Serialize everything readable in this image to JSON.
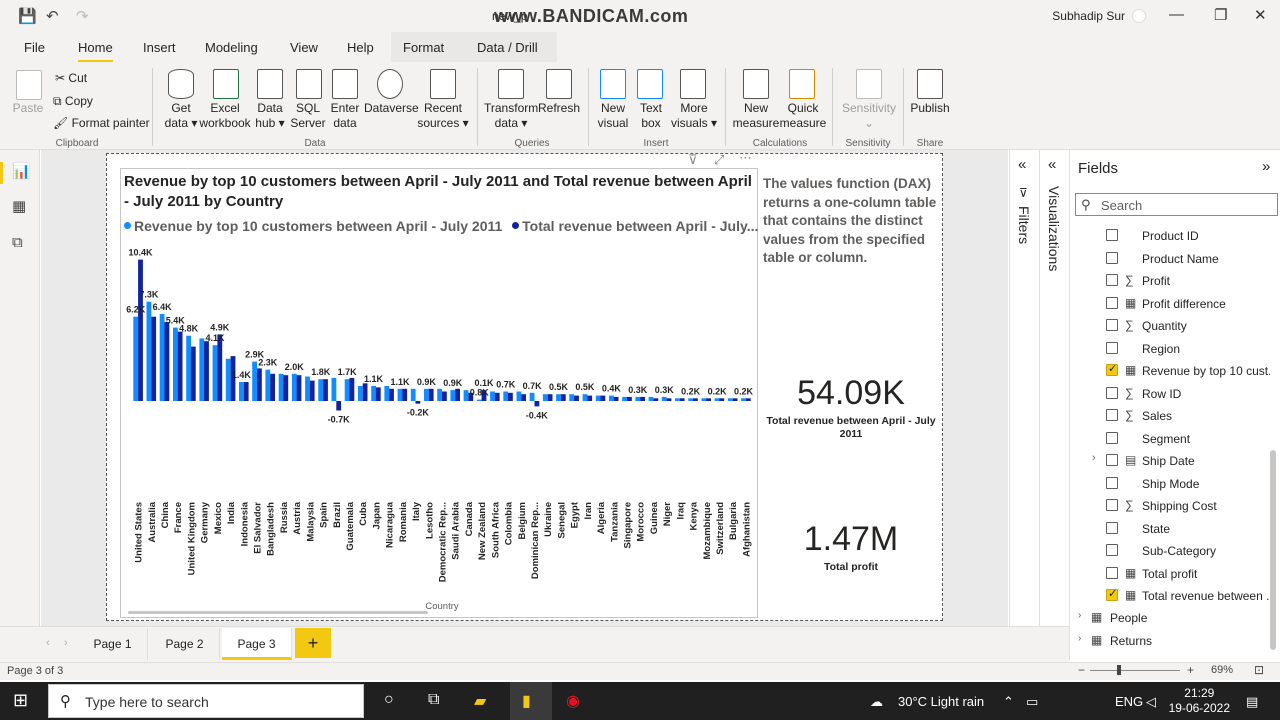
{
  "titlebar": {
    "title": "new_p",
    "watermark": "www.BANDICAM.com",
    "user": "Subhadip Sur"
  },
  "menu": [
    "File",
    "Home",
    "Insert",
    "Modeling",
    "View",
    "Help",
    "Format",
    "Data / Drill"
  ],
  "ribbon": {
    "paste": "Paste",
    "cut": "Cut",
    "copy": "Copy",
    "format_painter": "Format painter",
    "get_data": [
      "Get",
      "data ▾"
    ],
    "excel": [
      "Excel",
      "workbook"
    ],
    "data_hub": [
      "Data",
      "hub ▾"
    ],
    "sql": [
      "SQL",
      "Server"
    ],
    "enter_data": [
      "Enter",
      "data"
    ],
    "dataverse": "Dataverse",
    "recent": [
      "Recent",
      "sources ▾"
    ],
    "transform": [
      "Transform",
      "data ▾"
    ],
    "refresh": "Refresh",
    "new_visual": [
      "New",
      "visual"
    ],
    "text_box": [
      "Text",
      "box"
    ],
    "more_visuals": [
      "More",
      "visuals ▾"
    ],
    "new_measure": [
      "New",
      "measure"
    ],
    "quick_measure": [
      "Quick",
      "measure"
    ],
    "sensitivity": "Sensitivity",
    "publish": "Publish",
    "groups": [
      "Clipboard",
      "Data",
      "Queries",
      "Insert",
      "Calculations",
      "Sensitivity",
      "Share"
    ]
  },
  "chart_data": {
    "type": "bar",
    "title": "Revenue by top 10 customers between April - July 2011 and Total revenue between April - July 2011 by Country",
    "xlabel": "Country",
    "ylabel": "",
    "legend": "top",
    "categories": [
      "United States",
      "Australia",
      "China",
      "France",
      "United Kingdom",
      "Germany",
      "Mexico",
      "India",
      "Indonesia",
      "El Salvador",
      "Bangladesh",
      "Russia",
      "Austria",
      "Malaysia",
      "Spain",
      "Brazil",
      "Guatemala",
      "Cuba",
      "Japan",
      "Nicaragua",
      "Romania",
      "Italy",
      "Lesotho",
      "Democratic Rep...",
      "Saudi Arabia",
      "Canada",
      "New Zealand",
      "South Africa",
      "Colombia",
      "Belgium",
      "Dominican Rep...",
      "Ukraine",
      "Senegal",
      "Egypt",
      "Iran",
      "Algeria",
      "Tanzania",
      "Singapore",
      "Morocco",
      "Guinea",
      "Niger",
      "Iraq",
      "Kenya",
      "Mozambique",
      "Switzerland",
      "Bulgaria",
      "Afghanistan"
    ],
    "series": [
      {
        "name": "Revenue by top 10 customers between April - July 2011",
        "color": "#118dff",
        "values": [
          6.2,
          7.3,
          6.4,
          5.4,
          4.8,
          4.6,
          4.1,
          3.1,
          1.4,
          2.9,
          2.3,
          2.0,
          2.0,
          1.8,
          1.6,
          1.7,
          1.6,
          1.1,
          1.1,
          1.1,
          0.9,
          0.9,
          0.9,
          0.9,
          0.8,
          0.8,
          0.1,
          0.7,
          0.7,
          0.7,
          0.6,
          0.5,
          0.5,
          0.5,
          0.5,
          0.4,
          0.4,
          0.3,
          0.3,
          0.3,
          0.3,
          0.2,
          0.2,
          0.2,
          0.2,
          0.2,
          0.2
        ]
      },
      {
        "name": "Total revenue between April - July...",
        "color": "#12239e",
        "values": [
          10.4,
          6.2,
          5.8,
          5.1,
          4.0,
          4.4,
          4.9,
          3.3,
          1.4,
          2.4,
          2.0,
          1.9,
          1.9,
          1.5,
          1.6,
          -0.7,
          1.7,
          1.3,
          1.0,
          0.9,
          0.9,
          -0.2,
          0.9,
          0.7,
          0.9,
          0.6,
          0.8,
          0.6,
          0.6,
          0.5,
          -0.4,
          0.5,
          0.5,
          0.4,
          0.4,
          0.4,
          0.3,
          0.3,
          0.3,
          0.2,
          0.2,
          0.2,
          0.2,
          0.2,
          0.2,
          0.2,
          0.2
        ]
      }
    ],
    "data_labels": [
      {
        "i": 0,
        "s": 1,
        "text": "10.4K"
      },
      {
        "i": 0,
        "s": 0,
        "text": "6.2K"
      },
      {
        "i": 1,
        "s": 0,
        "text": "7.3K"
      },
      {
        "i": 2,
        "s": 0,
        "text": "6.4K"
      },
      {
        "i": 3,
        "s": 0,
        "text": "5.4K"
      },
      {
        "i": 4,
        "s": 0,
        "text": "4.8K"
      },
      {
        "i": 6,
        "s": 1,
        "text": "4.9K"
      },
      {
        "i": 6,
        "s": 0,
        "text": "4.1K"
      },
      {
        "i": 8,
        "s": 0,
        "text": "1.4K"
      },
      {
        "i": 9,
        "s": 0,
        "text": "2.9K"
      },
      {
        "i": 10,
        "s": 0,
        "text": "2.3K"
      },
      {
        "i": 12,
        "s": 0,
        "text": "2.0K"
      },
      {
        "i": 14,
        "s": 0,
        "text": "1.8K"
      },
      {
        "i": 15,
        "s": 1,
        "text": "-0.7K"
      },
      {
        "i": 16,
        "s": 0,
        "text": "1.7K"
      },
      {
        "i": 18,
        "s": 0,
        "text": "1.1K"
      },
      {
        "i": 20,
        "s": 0,
        "text": "1.1K"
      },
      {
        "i": 21,
        "s": 1,
        "text": "-0.2K"
      },
      {
        "i": 22,
        "s": 0,
        "text": "0.9K"
      },
      {
        "i": 24,
        "s": 0,
        "text": "0.9K"
      },
      {
        "i": 26,
        "s": 0,
        "text": "0.8K"
      },
      {
        "i": 26,
        "s": 1,
        "text": "0.1K"
      },
      {
        "i": 28,
        "s": 0,
        "text": "0.7K"
      },
      {
        "i": 30,
        "s": 0,
        "text": "0.7K"
      },
      {
        "i": 30,
        "s": 1,
        "text": "-0.4K"
      },
      {
        "i": 32,
        "s": 0,
        "text": "0.5K"
      },
      {
        "i": 34,
        "s": 0,
        "text": "0.5K"
      },
      {
        "i": 36,
        "s": 0,
        "text": "0.4K"
      },
      {
        "i": 38,
        "s": 0,
        "text": "0.3K"
      },
      {
        "i": 40,
        "s": 0,
        "text": "0.3K"
      },
      {
        "i": 42,
        "s": 0,
        "text": "0.2K"
      },
      {
        "i": 44,
        "s": 0,
        "text": "0.2K"
      },
      {
        "i": 46,
        "s": 0,
        "text": "0.2K"
      }
    ],
    "ylim": [
      -1,
      11
    ]
  },
  "legend_items": [
    "Revenue by top 10 customers between April - July 2011",
    "Total revenue between April - July..."
  ],
  "dax_text": "The values function (DAX) returns a one-column table that contains the distinct values from the specified table or column.",
  "cards": [
    {
      "value": "54.09K",
      "label": "Total revenue between April - July 2011"
    },
    {
      "value": "1.47M",
      "label": "Total profit"
    }
  ],
  "panes": {
    "filters": "Filters",
    "visualizations": "Visualizations",
    "fields": "Fields",
    "search_placeholder": "Search"
  },
  "fields": [
    {
      "name": "Product ID",
      "type": "",
      "checked": false
    },
    {
      "name": "Product Name",
      "type": "",
      "checked": false
    },
    {
      "name": "Profit",
      "type": "∑",
      "checked": false
    },
    {
      "name": "Profit difference",
      "type": "▦",
      "checked": false
    },
    {
      "name": "Quantity",
      "type": "∑",
      "checked": false
    },
    {
      "name": "Region",
      "type": "",
      "checked": false
    },
    {
      "name": "Revenue by top 10 cust...",
      "type": "▦",
      "checked": true
    },
    {
      "name": "Row ID",
      "type": "∑",
      "checked": false
    },
    {
      "name": "Sales",
      "type": "∑",
      "checked": false
    },
    {
      "name": "Segment",
      "type": "",
      "checked": false
    },
    {
      "name": "Ship Date",
      "type": "▤",
      "checked": false
    },
    {
      "name": "Ship Mode",
      "type": "",
      "checked": false
    },
    {
      "name": "Shipping Cost",
      "type": "∑",
      "checked": false
    },
    {
      "name": "State",
      "type": "",
      "checked": false
    },
    {
      "name": "Sub-Category",
      "type": "",
      "checked": false
    },
    {
      "name": "Total profit",
      "type": "▦",
      "checked": false
    },
    {
      "name": "Total revenue between ...",
      "type": "▦",
      "checked": true
    }
  ],
  "tables": [
    "People",
    "Returns"
  ],
  "pages": [
    "Page 1",
    "Page 2",
    "Page 3"
  ],
  "add_page": "+",
  "status": {
    "page": "Page 3 of 3",
    "zoom": "69%"
  },
  "taskbar": {
    "search_placeholder": "Type here to search",
    "weather": "30°C  Light rain",
    "lang": "ENG",
    "time": "21:29",
    "date": "19-06-2022"
  }
}
